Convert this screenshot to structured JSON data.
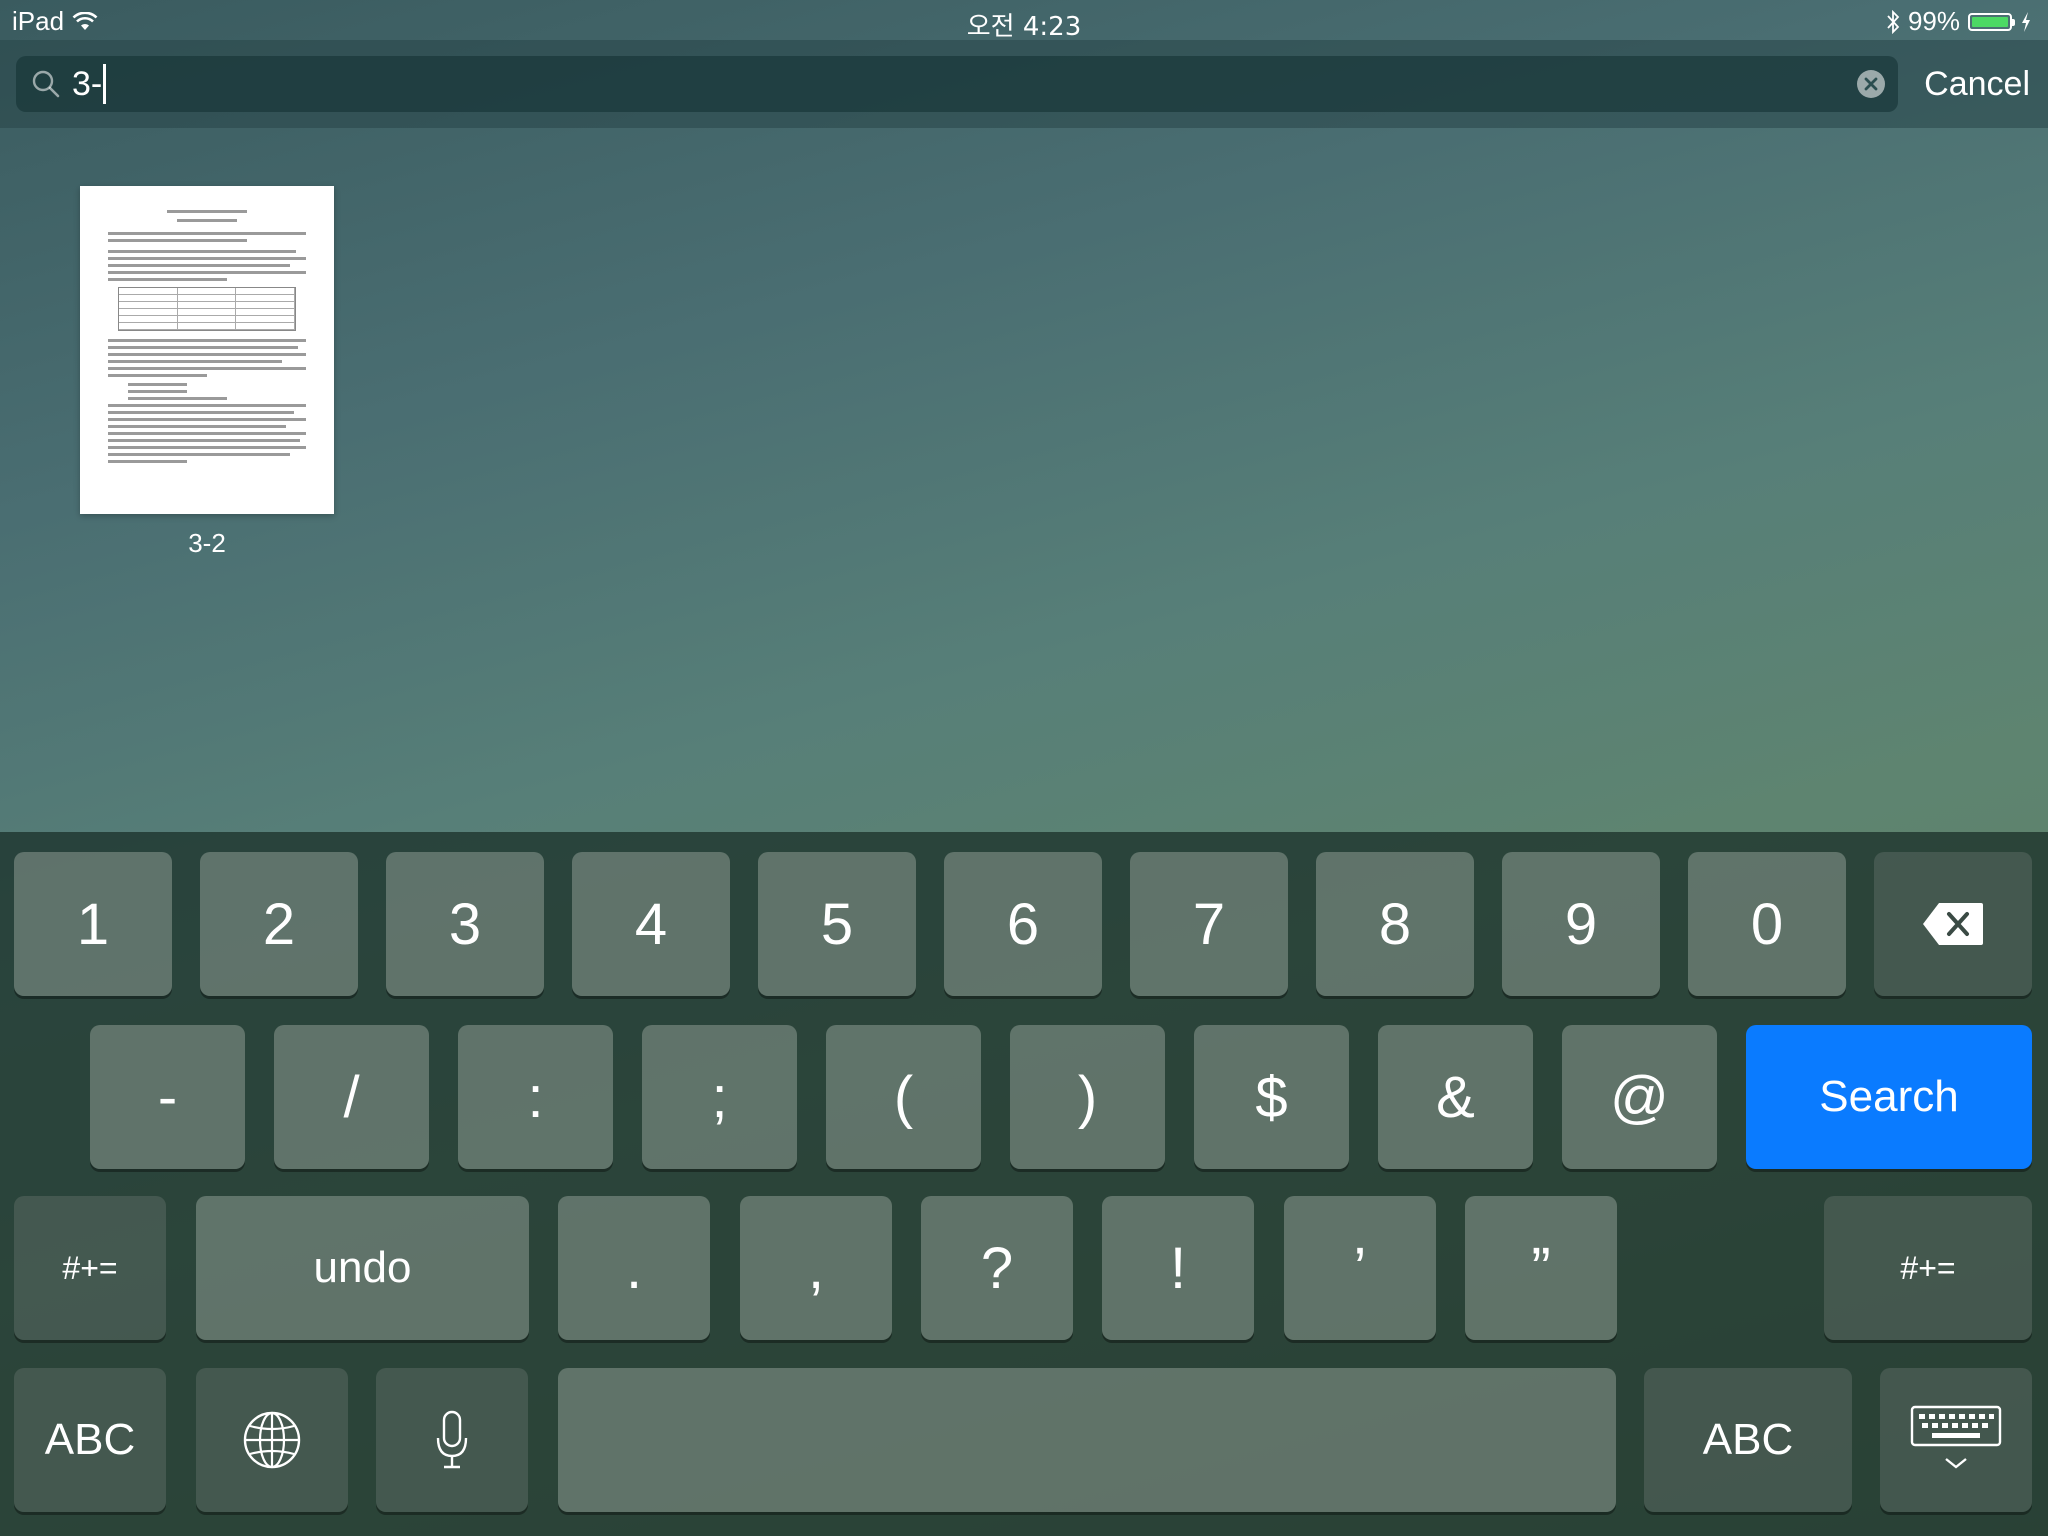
{
  "status_bar": {
    "device": "iPad",
    "time": "오전 4:23",
    "battery_percent": "99%",
    "battery_level": 0.99,
    "battery_color": "#4cd964"
  },
  "search": {
    "query": "3-",
    "cancel_label": "Cancel"
  },
  "results": [
    {
      "label": "3-2"
    }
  ],
  "keyboard": {
    "row1": [
      "1",
      "2",
      "3",
      "4",
      "5",
      "6",
      "7",
      "8",
      "9",
      "0"
    ],
    "row2": [
      "-",
      "/",
      ":",
      ";",
      "(",
      ")",
      "$",
      "&",
      "@"
    ],
    "search_label": "Search",
    "search_color": "#0a7bff",
    "symbols_label": "#+=",
    "undo_label": "undo",
    "row3": [
      ".",
      ",",
      "?",
      "!",
      "’",
      "”"
    ],
    "abc_label": "ABC",
    "icons": {
      "backspace": "backspace-icon",
      "globe": "globe-icon",
      "mic": "microphone-icon",
      "hide": "keyboard-hide-icon"
    }
  }
}
